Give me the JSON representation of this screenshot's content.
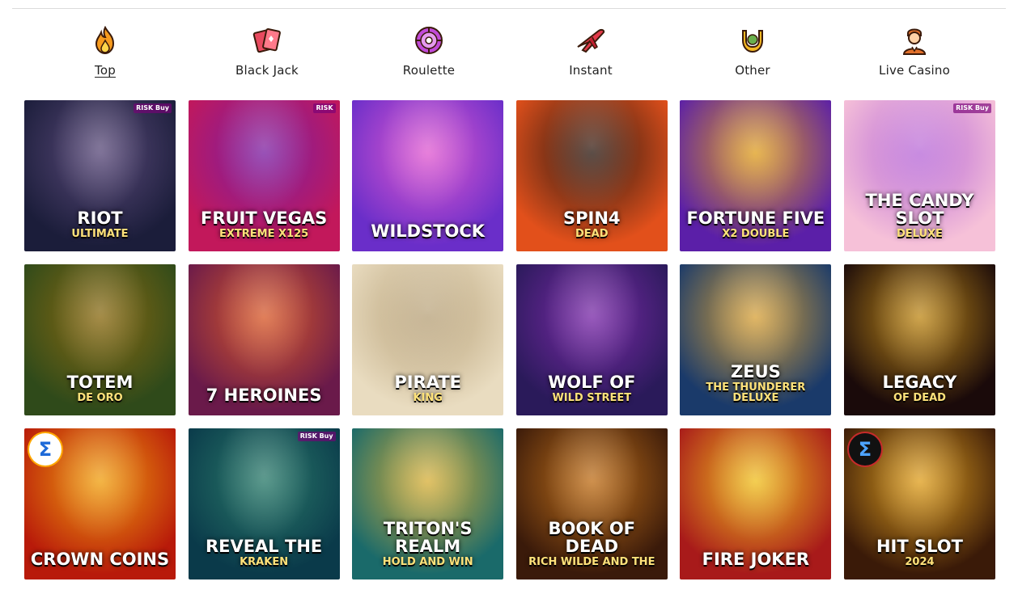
{
  "categories": [
    {
      "label": "Top",
      "icon": "flame-icon",
      "active": true
    },
    {
      "label": "Black Jack",
      "icon": "playing-cards-icon",
      "active": false
    },
    {
      "label": "Roulette",
      "icon": "roulette-chip-icon",
      "active": false
    },
    {
      "label": "Instant",
      "icon": "plane-icon",
      "active": false
    },
    {
      "label": "Other",
      "icon": "horseshoe-icon",
      "active": false
    },
    {
      "label": "Live Casino",
      "icon": "dealer-icon",
      "active": false
    }
  ],
  "games": [
    {
      "title": "Riot",
      "subtitle": "Ultimate",
      "badge": "RISK Buy"
    },
    {
      "title": "Fruit Vegas",
      "subtitle": "Extreme X125",
      "badge": "RISK"
    },
    {
      "title": "WildStock",
      "subtitle": "",
      "badge": ""
    },
    {
      "title": "Spin4",
      "subtitle": "Dead",
      "badge": ""
    },
    {
      "title": "Fortune Five",
      "subtitle": "x2 Double",
      "badge": ""
    },
    {
      "title": "The Candy Slot",
      "subtitle": "Deluxe",
      "badge": "RISK Buy"
    },
    {
      "title": "Totem",
      "subtitle": "De Oro",
      "badge": ""
    },
    {
      "title": "7 Heroines",
      "subtitle": "",
      "badge": ""
    },
    {
      "title": "Pirate",
      "subtitle": "King",
      "badge": ""
    },
    {
      "title": "Wolf of",
      "subtitle": "Wild Street",
      "badge": ""
    },
    {
      "title": "Zeus",
      "subtitle": "The Thunderer Deluxe",
      "badge": ""
    },
    {
      "title": "Legacy",
      "subtitle": "of Dead",
      "badge": ""
    },
    {
      "title": "Crown Coins",
      "subtitle": "",
      "badge": ""
    },
    {
      "title": "Reveal the",
      "subtitle": "Kraken",
      "badge": "RISK Buy"
    },
    {
      "title": "Triton's Realm",
      "subtitle": "Hold and Win",
      "badge": ""
    },
    {
      "title": "Book of Dead",
      "subtitle": "Rich Wilde and the",
      "badge": ""
    },
    {
      "title": "Fire Joker",
      "subtitle": "",
      "badge": ""
    },
    {
      "title": "Hit Slot",
      "subtitle": "2024",
      "badge": ""
    }
  ],
  "tile_colors": [
    [
      "#1b1d3a",
      "#5a4a7a"
    ],
    [
      "#c2185b",
      "#7b1fa2"
    ],
    [
      "#6a2ec9",
      "#e05ad0"
    ],
    [
      "#e2501b",
      "#2c1a12"
    ],
    [
      "#5b1fa8",
      "#e0a020"
    ],
    [
      "#f6c1d8",
      "#b86ad8"
    ],
    [
      "#2f4a1a",
      "#8a6a12"
    ],
    [
      "#6a1a4a",
      "#d85a2a"
    ],
    [
      "#e9dcc0",
      "#b8a27a"
    ],
    [
      "#2a1a5a",
      "#7a2aa8"
    ],
    [
      "#1a3a6a",
      "#d8a23a"
    ],
    [
      "#1a0a0a",
      "#c08a1a"
    ],
    [
      "#b81a0a",
      "#f0a010"
    ],
    [
      "#0a3a4a",
      "#2a7a6a"
    ],
    [
      "#1a6a6a",
      "#d8b03a"
    ],
    [
      "#3a1a0a",
      "#c0701a"
    ],
    [
      "#a81a1a",
      "#f0c020"
    ],
    [
      "#3a1a08",
      "#e0a020"
    ]
  ]
}
